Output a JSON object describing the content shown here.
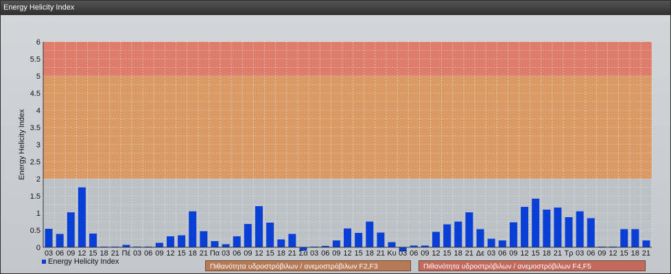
{
  "window": {
    "title": "Energy Helicity Index"
  },
  "chart_data": {
    "type": "bar",
    "title": "",
    "ylabel": "Energy Helicity Index",
    "xlabel": "",
    "ylim": [
      0,
      6
    ],
    "yticks": [
      "0",
      "0.5",
      "1",
      "1.5",
      "2",
      "2.5",
      "3",
      "3.5",
      "4",
      "4.5",
      "5",
      "5.5",
      "6"
    ],
    "categories": [
      "03",
      "06",
      "09",
      "12",
      "15",
      "18",
      "21",
      "Πέ",
      "03",
      "06",
      "09",
      "12",
      "15",
      "18",
      "21",
      "Πα",
      "03",
      "06",
      "09",
      "12",
      "15",
      "18",
      "21",
      "Σα",
      "03",
      "06",
      "09",
      "12",
      "15",
      "18",
      "21",
      "Κυ",
      "03",
      "06",
      "09",
      "12",
      "15",
      "18",
      "21",
      "Δε",
      "03",
      "06",
      "09",
      "12",
      "15",
      "18",
      "21",
      "Τρ",
      "03",
      "06",
      "09",
      "12",
      "15",
      "18",
      "21"
    ],
    "series": [
      {
        "name": "Energy Helicity Index",
        "color": "#0a3fd6",
        "values": [
          0.54,
          0.39,
          1.02,
          1.75,
          0.4,
          0.02,
          0.02,
          0.07,
          0.02,
          0.02,
          0.13,
          0.32,
          0.35,
          1.05,
          0.47,
          0.18,
          0.09,
          0.32,
          0.68,
          1.2,
          0.72,
          0.23,
          0.39,
          -0.1,
          0.02,
          0.04,
          0.2,
          0.55,
          0.42,
          0.75,
          0.43,
          0.15,
          -0.12,
          0.05,
          0.05,
          0.45,
          0.67,
          0.75,
          1.02,
          0.53,
          0.25,
          0.2,
          0.73,
          1.18,
          1.42,
          1.1,
          1.16,
          0.88,
          1.05,
          0.85,
          0.02,
          0.02,
          0.53,
          0.53,
          0.2
        ]
      }
    ],
    "bands": [
      {
        "from": 0,
        "to": 2,
        "color": "#bcc1c8"
      },
      {
        "from": 2,
        "to": 5,
        "color": "#d99a66",
        "label": "Πιθανότητα υδροστρόβιλων / ανεμοστρόβιλων F2,F3"
      },
      {
        "from": 5,
        "to": 6,
        "color": "#de7d6c",
        "label": "Πιθανότητα υδροστρόβιλων / ανεμοστρόβιλων F4,F5"
      }
    ],
    "grid": true,
    "legend": "bottom-left"
  }
}
